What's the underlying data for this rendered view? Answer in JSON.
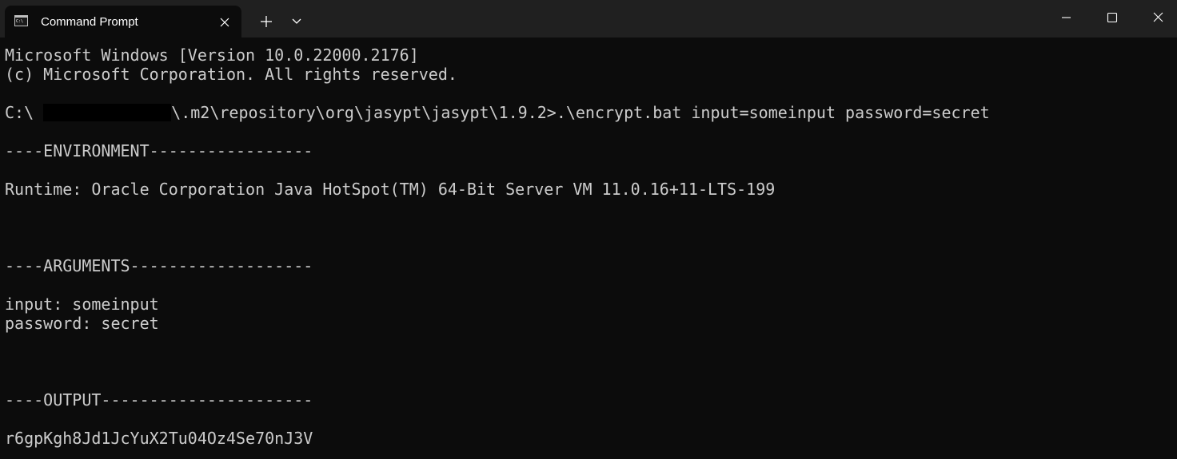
{
  "window": {
    "tab_title": "Command Prompt",
    "tab_icon": "cmd-icon",
    "controls": {
      "close_tab_icon": "close-icon",
      "new_tab_icon": "plus-icon",
      "dropdown_icon": "chevron-down-icon",
      "minimize_icon": "minimize-icon",
      "maximize_icon": "maximize-icon",
      "close_window_icon": "close-icon"
    }
  },
  "console": {
    "header_line1": "Microsoft Windows [Version 10.0.22000.2176]",
    "header_line2": "(c) Microsoft Corporation. All rights reserved.",
    "prompt_prefix": "C:\\ ",
    "prompt_suffix": "\\.m2\\repository\\org\\jasypt\\jasypt\\1.9.2>.\\encrypt.bat input=someinput password=secret",
    "env_header": "----ENVIRONMENT-----------------",
    "runtime": "Runtime: Oracle Corporation Java HotSpot(TM) 64-Bit Server VM 11.0.16+11-LTS-199",
    "args_header": "----ARGUMENTS-------------------",
    "arg_input": "input: someinput",
    "arg_password": "password: secret",
    "output_header": "----OUTPUT----------------------",
    "output_value": "r6gpKgh8Jd1JcYuX2Tu04Oz4Se70nJ3V"
  },
  "colors": {
    "background": "#0c0c0c",
    "titlebar": "#202020",
    "text": "#cccccc",
    "tab_text": "#ffffff"
  }
}
